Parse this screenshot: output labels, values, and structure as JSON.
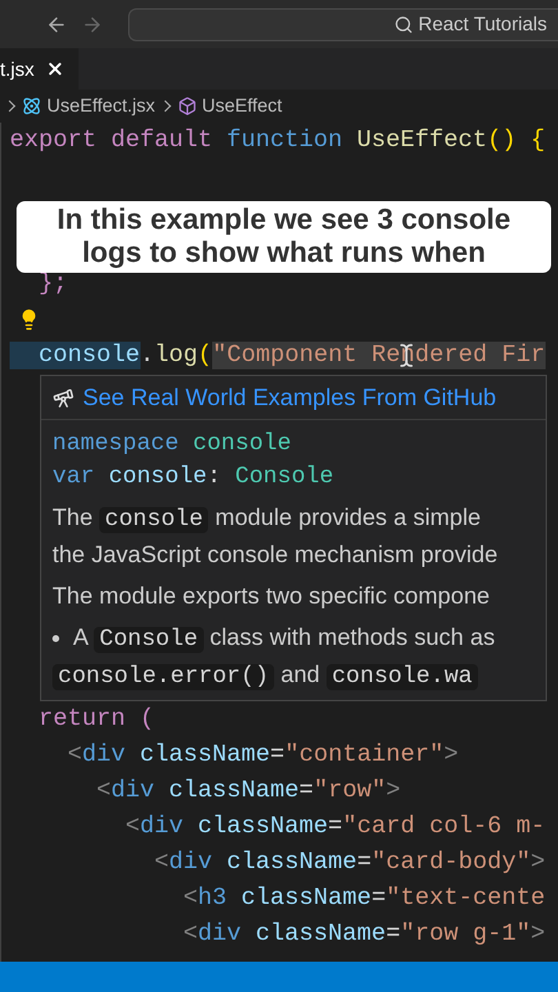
{
  "titlebar": {
    "search_text": "React Tutorials"
  },
  "tab": {
    "label": "t.jsx"
  },
  "breadcrumb": [
    {
      "kind": "file",
      "label": "UseEffect.jsx"
    },
    {
      "kind": "symbol",
      "label": "UseEffect"
    }
  ],
  "caption": "In this example we see 3 console logs to show what runs when",
  "lines_top": [
    {
      "kind": "code",
      "tokens": [
        {
          "t": "export default ",
          "kind": "keyword"
        },
        {
          "t": "function ",
          "kind": "storage"
        },
        {
          "t": "UseEffect",
          "kind": "func"
        },
        {
          "t": "() {",
          "kind": "paren"
        }
      ]
    },
    {
      "kind": "blank"
    },
    {
      "kind": "blank"
    },
    {
      "kind": "blank"
    },
    {
      "kind": "code",
      "tokens": [
        {
          "t": "  };",
          "kind": "keyword"
        }
      ]
    },
    {
      "kind": "lightbulb"
    },
    {
      "kind": "code",
      "tokens": [
        {
          "t": "  console",
          "kind": "variable",
          "highlighted": true
        },
        {
          "t": ".",
          "kind": "plain",
          "highlighted": false
        },
        {
          "t": "log",
          "kind": "func",
          "highlighted": false
        },
        {
          "t": "(",
          "kind": "paren",
          "highlighted": false
        },
        {
          "t": "\"Component Rendered Fir",
          "kind": "string",
          "highlighted": true
        }
      ]
    }
  ],
  "hover": {
    "link": "See Real World Examples From GitHub",
    "signature": [
      [
        {
          "t": "namespace ",
          "kind": "storage"
        },
        {
          "t": "console",
          "kind": "type"
        }
      ],
      [
        {
          "t": "var ",
          "kind": "storage"
        },
        {
          "t": "console",
          "kind": "variable"
        },
        {
          "t": ": ",
          "kind": "plain"
        },
        {
          "t": "Console",
          "kind": "type"
        }
      ]
    ],
    "doc": [
      {
        "kind": "line",
        "parts": [
          {
            "kind": "text",
            "t": "The "
          },
          {
            "kind": "code",
            "t": "console"
          },
          {
            "kind": "text",
            "t": " module provides a simple"
          }
        ]
      },
      {
        "kind": "line",
        "parts": [
          {
            "kind": "text",
            "t": "the JavaScript console mechanism provide"
          }
        ]
      },
      {
        "kind": "para",
        "parts": [
          {
            "kind": "text",
            "t": "The module exports two specific compone"
          }
        ]
      },
      {
        "kind": "bullet",
        "parts": [
          {
            "kind": "text",
            "t": "A "
          },
          {
            "kind": "code",
            "t": "Console"
          },
          {
            "kind": "text",
            "t": " class with methods such as"
          }
        ]
      },
      {
        "kind": "line",
        "parts": [
          {
            "kind": "code",
            "t": "console.error()"
          },
          {
            "kind": "text",
            "t": " and "
          },
          {
            "kind": "code",
            "t": "console.wa"
          }
        ]
      }
    ]
  },
  "lines_bottom": [
    {
      "kind": "code",
      "tokens": [
        {
          "t": "  return (",
          "kind": "keyword"
        }
      ]
    },
    {
      "kind": "code",
      "tokens": [
        {
          "t": "    <",
          "kind": "tag"
        },
        {
          "t": "div ",
          "kind": "storage"
        },
        {
          "t": "className",
          "kind": "variable"
        },
        {
          "t": "=",
          "kind": "plain"
        },
        {
          "t": "\"container\"",
          "kind": "string"
        },
        {
          "t": ">",
          "kind": "tag"
        }
      ]
    },
    {
      "kind": "code",
      "tokens": [
        {
          "t": "      <",
          "kind": "tag"
        },
        {
          "t": "div ",
          "kind": "storage"
        },
        {
          "t": "className",
          "kind": "variable"
        },
        {
          "t": "=",
          "kind": "plain"
        },
        {
          "t": "\"row\"",
          "kind": "string"
        },
        {
          "t": ">",
          "kind": "tag"
        }
      ]
    },
    {
      "kind": "code",
      "tokens": [
        {
          "t": "        <",
          "kind": "tag"
        },
        {
          "t": "div ",
          "kind": "storage"
        },
        {
          "t": "className",
          "kind": "variable"
        },
        {
          "t": "=",
          "kind": "plain"
        },
        {
          "t": "\"card col-6 m-",
          "kind": "string"
        }
      ]
    },
    {
      "kind": "code",
      "tokens": [
        {
          "t": "          <",
          "kind": "tag"
        },
        {
          "t": "div ",
          "kind": "storage"
        },
        {
          "t": "className",
          "kind": "variable"
        },
        {
          "t": "=",
          "kind": "plain"
        },
        {
          "t": "\"card-body\"",
          "kind": "string"
        },
        {
          "t": ">",
          "kind": "tag"
        }
      ]
    },
    {
      "kind": "code",
      "tokens": [
        {
          "t": "            <",
          "kind": "tag"
        },
        {
          "t": "h3 ",
          "kind": "storage"
        },
        {
          "t": "className",
          "kind": "variable"
        },
        {
          "t": "=",
          "kind": "plain"
        },
        {
          "t": "\"text-cente",
          "kind": "string"
        }
      ]
    },
    {
      "kind": "code",
      "tokens": [
        {
          "t": "            <",
          "kind": "tag"
        },
        {
          "t": "div ",
          "kind": "storage"
        },
        {
          "t": "className",
          "kind": "variable"
        },
        {
          "t": "=",
          "kind": "plain"
        },
        {
          "t": "\"row g-1\"",
          "kind": "string"
        },
        {
          "t": ">",
          "kind": "tag"
        }
      ]
    }
  ]
}
